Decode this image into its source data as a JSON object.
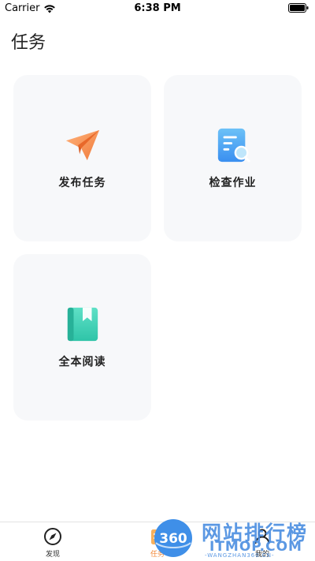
{
  "status_bar": {
    "carrier": "Carrier",
    "time": "6:38 PM"
  },
  "header": {
    "title": "任务"
  },
  "cards": [
    {
      "label": "发布任务",
      "icon": "paper-plane-icon"
    },
    {
      "label": "检查作业",
      "icon": "document-search-icon"
    },
    {
      "label": "全本阅读",
      "icon": "book-icon"
    }
  ],
  "tab_bar": {
    "items": [
      {
        "label": "发现",
        "icon": "compass-icon"
      },
      {
        "label": "任务",
        "icon": "task-icon",
        "active": true
      },
      {
        "label": "我的",
        "icon": "profile-icon"
      }
    ],
    "active_color": "#f28a3a"
  },
  "watermark": {
    "logo_text": "360",
    "cn_text": "网站排行榜",
    "en_text": "ITMOP.COM",
    "sub_text": "-WANGZHAN360.CN-"
  }
}
